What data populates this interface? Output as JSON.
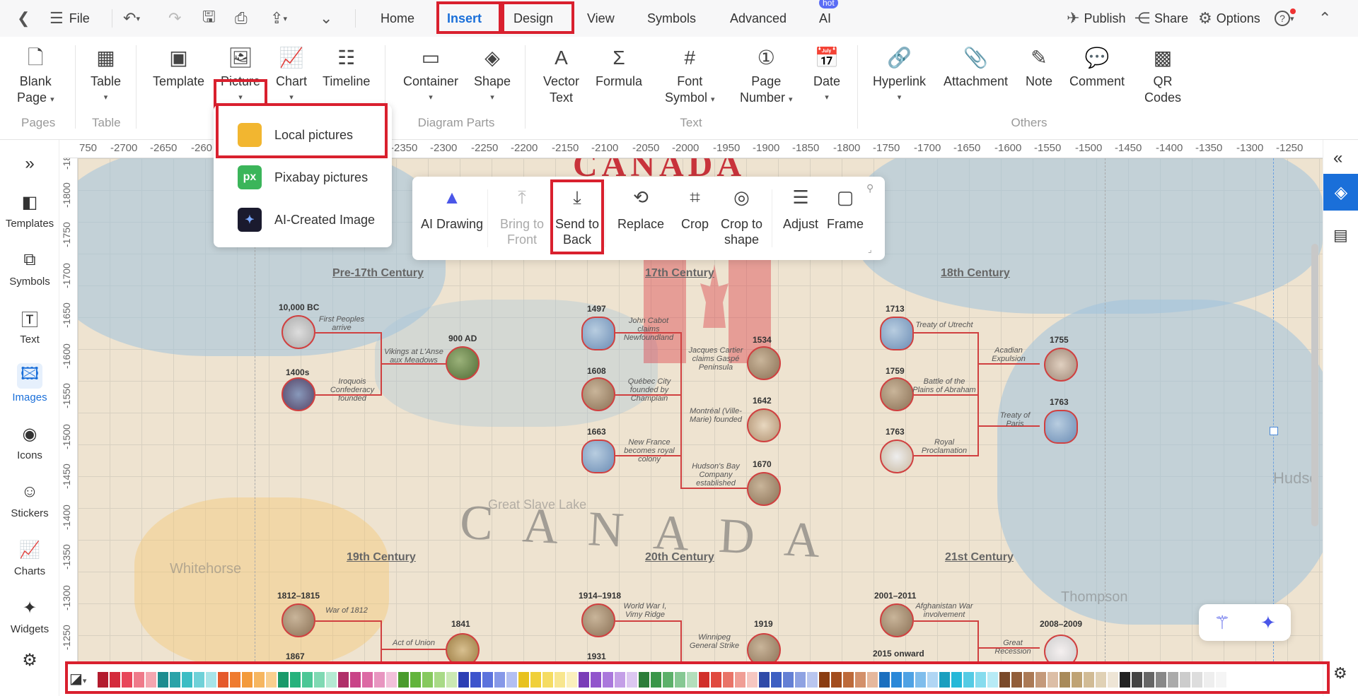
{
  "topbar": {
    "file_label": "File",
    "menus": [
      "Home",
      "Insert",
      "Design",
      "View",
      "Symbols",
      "Advanced",
      "AI"
    ],
    "active_menu": "Insert",
    "ai_badge": "hot",
    "publish": "Publish",
    "share": "Share",
    "options": "Options"
  },
  "ribbon": {
    "pages": {
      "blank_page_1": "Blank",
      "blank_page_2": "Page",
      "group": "Pages"
    },
    "table": {
      "label": "Table",
      "group": "Table"
    },
    "template": "Template",
    "picture": "Picture",
    "chart": "Chart",
    "timeline": "Timeline",
    "container": "Container",
    "shape": "Shape",
    "diagram_group": "Diagram Parts",
    "vector_text_1": "Vector",
    "vector_text_2": "Text",
    "formula": "Formula",
    "font_symbol_1": "Font",
    "font_symbol_2": "Symbol",
    "page_number_1": "Page",
    "page_number_2": "Number",
    "date": "Date",
    "text_group": "Text",
    "hyperlink": "Hyperlink",
    "attachment": "Attachment",
    "note": "Note",
    "comment": "Comment",
    "qr_1": "QR",
    "qr_2": "Codes",
    "others_group": "Others"
  },
  "picture_menu": {
    "local": "Local pictures",
    "pixabay": "Pixabay pictures",
    "pixabay_icon": "px",
    "ai_image": "AI-Created Image"
  },
  "context_toolbar": {
    "ai_drawing": "AI Drawing",
    "bring_front_1": "Bring to",
    "bring_front_2": "Front",
    "send_back_1": "Send to",
    "send_back_2": "Back",
    "replace": "Replace",
    "crop": "Crop",
    "crop_shape_1": "Crop to",
    "crop_shape_2": "shape",
    "adjust": "Adjust",
    "frame": "Frame"
  },
  "left_sidebar": [
    "Templates",
    "Symbols",
    "Text",
    "Images",
    "Icons",
    "Stickers",
    "Charts",
    "Widgets"
  ],
  "ruler_top": [
    "750",
    "-2700",
    "-2650",
    "-260",
    "-2350",
    "-2300",
    "-2250",
    "-2200",
    "-2150",
    "-2100",
    "-2050",
    "-2000",
    "-1950",
    "-1900",
    "-1850",
    "-1800",
    "-1750",
    "-1700",
    "-1650",
    "-1600",
    "-1550",
    "-1500",
    "-1450",
    "-1400",
    "-1350",
    "-1300",
    "-1250"
  ],
  "ruler_left": [
    "-18",
    "-1800",
    "-1750",
    "-1700",
    "-1650",
    "-1600",
    "-1550",
    "-1500",
    "-1450",
    "-1400",
    "-1350",
    "-1300",
    "-1250"
  ],
  "canvas": {
    "title_partial": "CANADA",
    "map_label": "CANADA",
    "map_places": {
      "great_slave": "Great Slave Lake",
      "whitehorse": "Whitehorse",
      "thompson": "Thompson",
      "hudson": "Hudso"
    },
    "centuries": [
      "Pre-17th Century",
      "17th Century",
      "18th Century",
      "19th Century",
      "20th Century",
      "21st Century"
    ],
    "pre17": [
      {
        "year": "10,000 BC",
        "event": "First Peoples arrive"
      },
      {
        "year": "1400s",
        "event": "Iroquois Confederacy founded"
      },
      {
        "year": "900 AD",
        "event": "Vikings at L'Anse aux Meadows"
      }
    ],
    "c17": [
      {
        "year": "1497",
        "event": "John Cabot claims Newfoundland"
      },
      {
        "year": "1608",
        "event": "Québec City founded by Champlain"
      },
      {
        "year": "1663",
        "event": "New France becomes royal colony"
      },
      {
        "year": "1534",
        "event": "Jacques Cartier claims Gaspé Peninsula"
      },
      {
        "year": "1642",
        "event": "Montréal (Ville-Marie) founded"
      },
      {
        "year": "1670",
        "event": "Hudson's Bay Company established"
      }
    ],
    "c18": [
      {
        "year": "1713",
        "event": "Treaty of Utrecht"
      },
      {
        "year": "1759",
        "event": "Battle of the Plains of Abraham"
      },
      {
        "year": "1763",
        "event": "Royal Proclamation"
      },
      {
        "year": "1755",
        "event": "Acadian Expulsion"
      },
      {
        "year": "1763",
        "event": "Treaty of Paris"
      }
    ],
    "c19": [
      {
        "year": "1812–1815",
        "event": "War of 1812"
      },
      {
        "year": "1867",
        "event": ""
      },
      {
        "year": "1841",
        "event": "Act of Union"
      }
    ],
    "c20": [
      {
        "year": "1914–1918",
        "event": "World War I, Vimy Ridge"
      },
      {
        "year": "1931",
        "event": ""
      },
      {
        "year": "1919",
        "event": "Winnipeg General Strike"
      }
    ],
    "c21": [
      {
        "year": "2001–2011",
        "event": "Afghanistan War involvement"
      },
      {
        "year": "2015 onward",
        "event": ""
      },
      {
        "year": "2008–2009",
        "event": "Great Recession"
      }
    ]
  },
  "palette": [
    "#b31b2e",
    "#d42b3c",
    "#e8465a",
    "#ef7a8a",
    "#f4a6b0",
    "#1d8c8f",
    "#2aa3a8",
    "#3bbdc4",
    "#6fd1d8",
    "#a7e4e8",
    "#e55a2b",
    "#ef7b2f",
    "#f39a3b",
    "#f6b660",
    "#f9cf8f",
    "#1a9a6b",
    "#26b27c",
    "#4cc796",
    "#7fd9b3",
    "#b4ead3",
    "#b0306a",
    "#c94488",
    "#dc6aa4",
    "#e895c0",
    "#f2c0da",
    "#4a9b2d",
    "#62b43c",
    "#86c95e",
    "#a9da87",
    "#cbe9b3",
    "#2d3fb5",
    "#3d54cc",
    "#5c73dd",
    "#8698e8",
    "#b3bff2",
    "#e8c21f",
    "#f0d03a",
    "#f5dc62",
    "#f8e68f",
    "#fbf0bd",
    "#7a3db8",
    "#9155cc",
    "#aa78dc",
    "#c49fe7",
    "#dcc7f1",
    "#2c7d3a",
    "#3a9649",
    "#5cb06a",
    "#86c893",
    "#b3debb",
    "#d1302b",
    "#e04a3f",
    "#e97468",
    "#f09e95",
    "#f6c7c1",
    "#2f4aa8",
    "#3d5fc2",
    "#6480d4",
    "#8ea2e2",
    "#b9c6ef",
    "#8a3d12",
    "#a34d1d",
    "#bd6a3a",
    "#d3906a",
    "#e6b89d",
    "#1b6fbf",
    "#2a88d8",
    "#4fa2e4",
    "#7fbdec",
    "#b0d6f4",
    "#1a9fbf",
    "#27b8d8",
    "#55cbe4",
    "#86dcee",
    "#b7ebf6",
    "#7a4a2a",
    "#925e3a",
    "#ab7a56",
    "#c49a7b",
    "#dcbea6",
    "#a88a5a",
    "#bfa374",
    "#d1bb95",
    "#e0d1b5",
    "#eee5d6",
    "#222222",
    "#444444",
    "#666666",
    "#888888",
    "#aaaaaa",
    "#cccccc",
    "#dddddd",
    "#eeeeee",
    "#f5f5f5"
  ]
}
